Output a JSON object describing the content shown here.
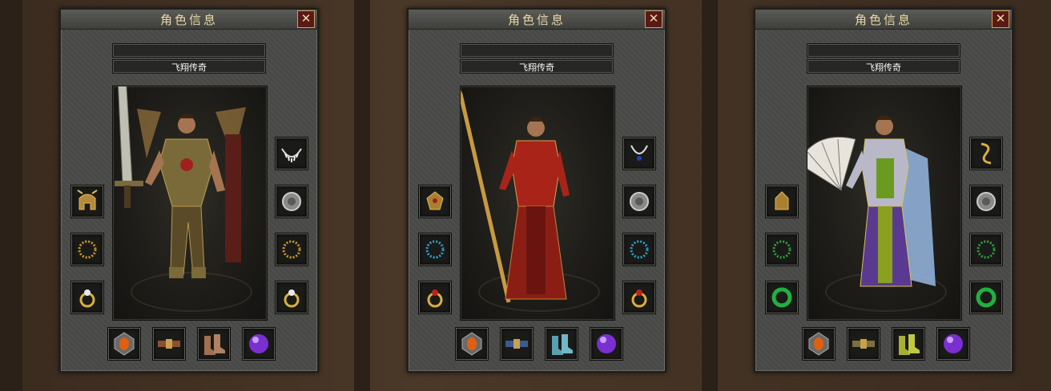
{
  "panels": [
    {
      "title": "角色信息",
      "close": "✕",
      "character_name": "飞翔传奇",
      "class": "warrior",
      "weapon": "sword-icon"
    },
    {
      "title": "角色信息",
      "close": "✕",
      "character_name": "飞翔传奇",
      "class": "mage",
      "weapon": "staff-icon"
    },
    {
      "title": "角色信息",
      "close": "✕",
      "character_name": "飞翔传奇",
      "class": "taoist",
      "weapon": "fan-icon"
    }
  ],
  "colors": {
    "title": "#e8d9a8",
    "panel": "#4a4a48",
    "close_bg": "#5a1a14"
  }
}
